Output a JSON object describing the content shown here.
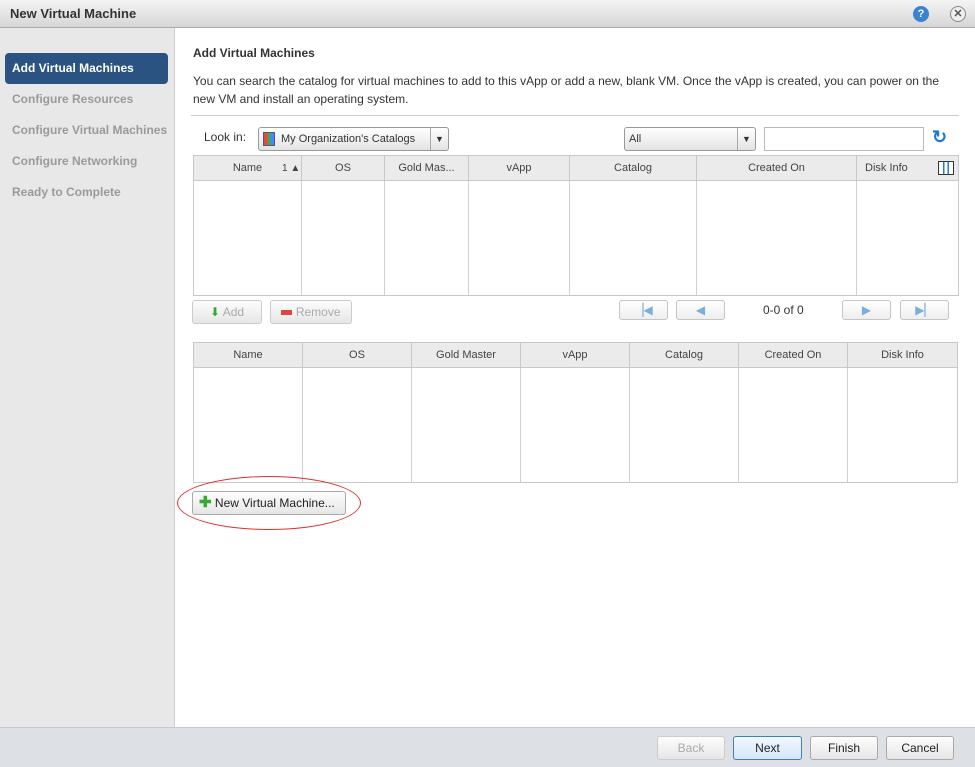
{
  "window": {
    "title": "New Virtual Machine",
    "help_icon": "help-icon",
    "close_icon": "close-icon"
  },
  "sidebar": {
    "steps": [
      {
        "label": "Add Virtual Machines",
        "active": true
      },
      {
        "label": "Configure Resources",
        "active": false
      },
      {
        "label": "Configure Virtual Machines",
        "active": false
      },
      {
        "label": "Configure Networking",
        "active": false
      },
      {
        "label": "Ready to Complete",
        "active": false
      }
    ]
  },
  "main": {
    "heading": "Add Virtual Machines",
    "description": "You can search the catalog for virtual machines to add to this vApp or add a new, blank VM. Once the vApp is created, you can power on the new VM and install an operating system.",
    "look_in_label": "Look in:",
    "look_in_value": "My Organization's Catalogs",
    "filter_value": "All",
    "search_value": "",
    "catalog_columns": [
      "Name",
      "OS",
      "Gold Mas...",
      "vApp",
      "Catalog",
      "Created On",
      "Disk Info"
    ],
    "sort_indicator": "1 ▲",
    "add_label": "Add",
    "remove_label": "Remove",
    "pager_text": "0-0 of 0",
    "selected_columns": [
      "Name",
      "OS",
      "Gold Master",
      "vApp",
      "Catalog",
      "Created On",
      "Disk Info"
    ],
    "new_vm_label": "New Virtual Machine...",
    "highlight_color": "#e03030"
  },
  "footer": {
    "back": "Back",
    "next": "Next",
    "finish": "Finish",
    "cancel": "Cancel"
  },
  "colors": {
    "accent": "#2a5381"
  }
}
